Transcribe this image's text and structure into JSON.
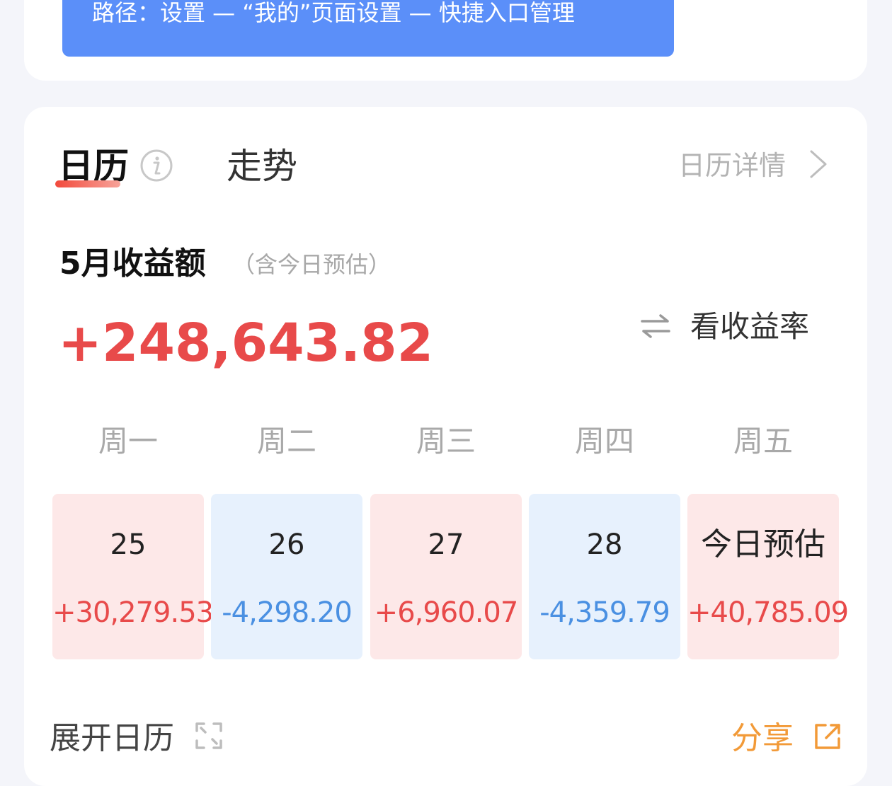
{
  "banner": {
    "path_text": "路径：设置 — “我的”页面设置 — 快捷入口管理"
  },
  "tabs": [
    {
      "label": "日历",
      "active": true
    },
    {
      "label": "走势",
      "active": false
    }
  ],
  "header": {
    "calendar_detail": "日历详情"
  },
  "summary": {
    "title": "5月收益额",
    "subtitle": "（含今日预估）",
    "total": "+248,643.82",
    "toggle_label": "看收益率"
  },
  "weekdays": [
    "周一",
    "周二",
    "周三",
    "周四",
    "周五"
  ],
  "days": [
    {
      "label": "25",
      "value": "+30,279.53",
      "sign": "positive"
    },
    {
      "label": "26",
      "value": "-4,298.20",
      "sign": "negative"
    },
    {
      "label": "27",
      "value": "+6,960.07",
      "sign": "positive"
    },
    {
      "label": "28",
      "value": "-4,359.79",
      "sign": "negative"
    },
    {
      "label": "今日预估",
      "value": "+40,785.09",
      "sign": "positive"
    }
  ],
  "footer": {
    "expand_label": "展开日历",
    "share_label": "分享"
  },
  "colors": {
    "positive": "#e84a4a",
    "negative": "#4a90e2",
    "positive_bg": "#fde8e8",
    "negative_bg": "#e7f1fd",
    "banner": "#5b8ff9",
    "share": "#f29a38"
  },
  "icons": [
    "info-icon",
    "chevron-right-icon",
    "swap-icon",
    "expand-icon",
    "share-icon"
  ]
}
